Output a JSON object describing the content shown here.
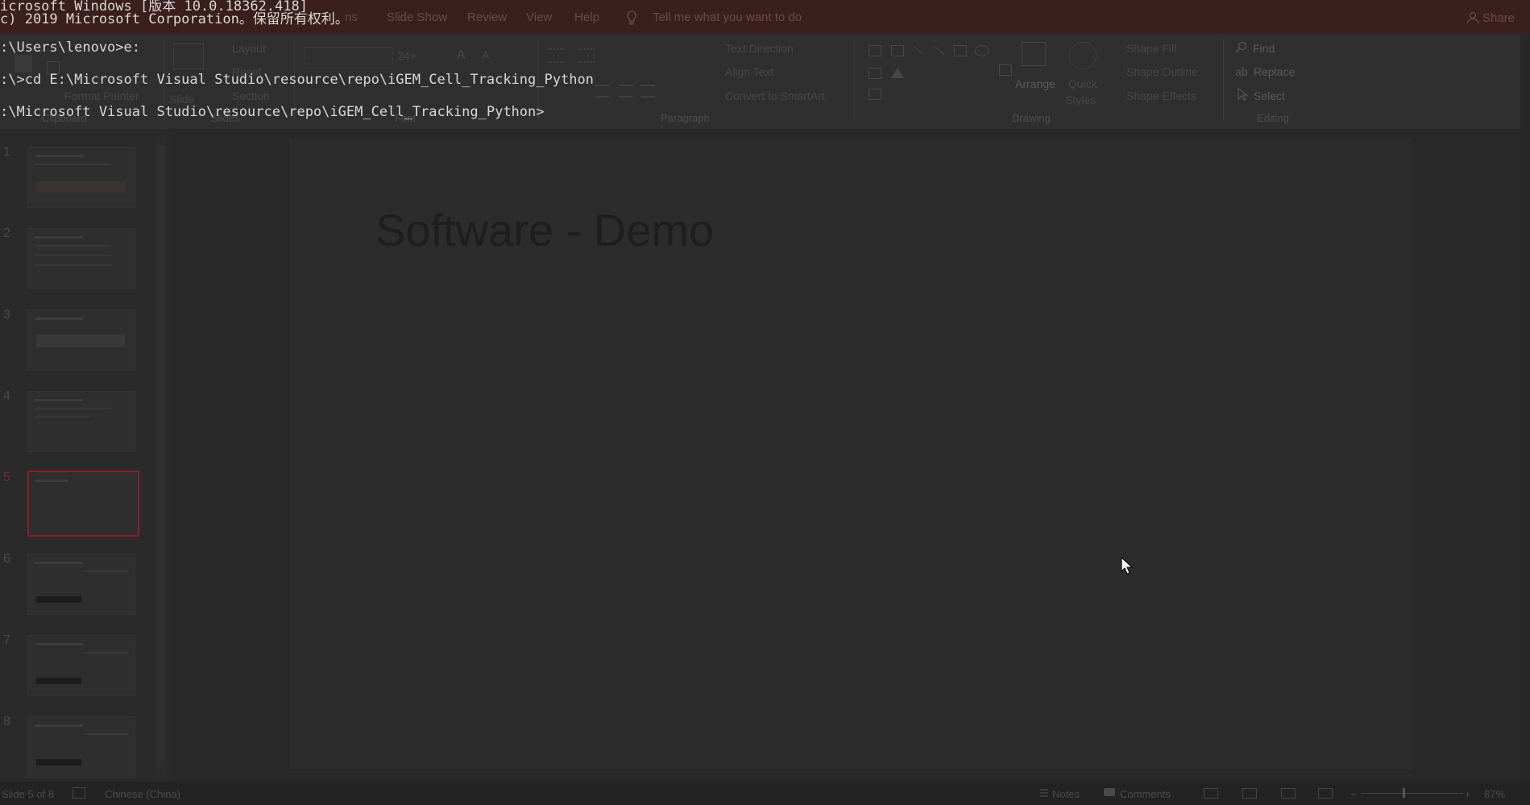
{
  "console": {
    "lines": [
      "icrosoft Windows [版本 10.0.18362.418]",
      "c) 2019 Microsoft Corporation。保留所有权利。",
      ":\\Users\\lenovo>e:",
      ":\\>cd E:\\Microsoft Visual Studio\\resource\\repo\\iGEM_Cell_Tracking_Python",
      ":\\Microsoft Visual Studio\\resource\\repo\\iGEM_Cell_Tracking_Python>"
    ]
  },
  "menu": {
    "tabs": [
      "ns",
      "Slide Show",
      "Review",
      "View",
      "Help"
    ],
    "tell_me": "Tell me what you want to do",
    "share": "Share"
  },
  "ribbon": {
    "clipboard": {
      "format_painter": "Format Painter",
      "group": "Clipboard"
    },
    "slides": {
      "layout": "Layout",
      "reset": "Reset",
      "section": "Section",
      "slide": "Slide",
      "group": "Slides"
    },
    "font": {
      "size": "24+",
      "group": "Font"
    },
    "paragraph": {
      "text_direction": "Text Direction",
      "align_text": "Align Text",
      "convert": "Convert to SmartArt",
      "group": "Paragraph"
    },
    "drawing": {
      "arrange": "Arrange",
      "quick_styles_1": "Quick",
      "quick_styles_2": "Styles",
      "shape_fill": "Shape Fill",
      "shape_outline": "Shape Outline",
      "shape_effects": "Shape Effects",
      "group": "Drawing"
    },
    "editing": {
      "find": "Find",
      "replace": "Replace",
      "select": "Select",
      "group": "Editing"
    }
  },
  "thumbnails": [
    "1",
    "2",
    "3",
    "4",
    "5",
    "6",
    "7",
    "8"
  ],
  "selected_slide": "5",
  "slide": {
    "title": "Software - Demo"
  },
  "status": {
    "slide_of": "Slide 5 of 8",
    "language": "Chinese (China)",
    "notes": "Notes",
    "comments": "Comments",
    "zoom": "87%"
  },
  "colors": {
    "accent": "#c8262f",
    "menubar": "#3a1f1d"
  }
}
